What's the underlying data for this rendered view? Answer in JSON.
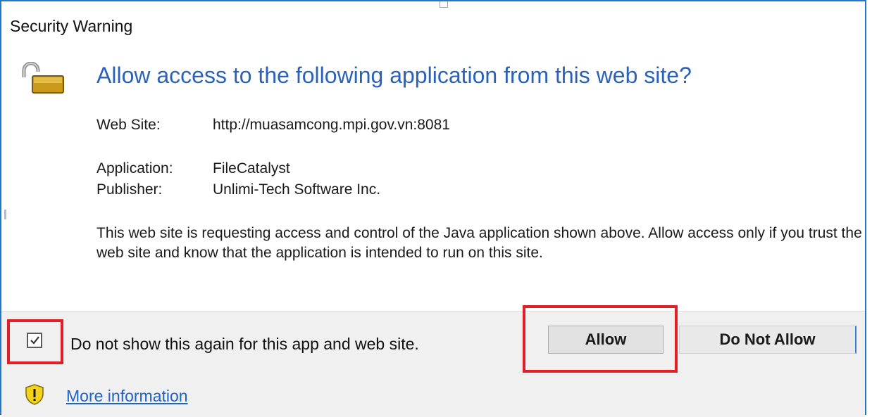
{
  "window": {
    "title": "Security Warning"
  },
  "header": {
    "question": "Allow access to the following application from this web site?",
    "icon": "padlock-open-icon"
  },
  "details": {
    "website_label": "Web Site:",
    "website_value": "http://muasamcong.mpi.gov.vn:8081",
    "application_label": "Application:",
    "application_value": "FileCatalyst",
    "publisher_label": "Publisher:",
    "publisher_value": "Unlimi-Tech Software Inc."
  },
  "description": "This web site is requesting access and control of the Java application shown above. Allow access only if you trust the web site and know that the application is intended to run on this site.",
  "footer": {
    "checkbox_label": "Do not show this again for this app and web site.",
    "checkbox_checked": true,
    "allow_label": "Allow",
    "deny_label": "Do Not Allow",
    "more_info_label": "More information",
    "info_icon": "warning-shield-icon"
  },
  "colors": {
    "accent": "#2a62b8",
    "highlight": "#e01f26",
    "link": "#1f63c4",
    "border": "#1f78c8"
  }
}
